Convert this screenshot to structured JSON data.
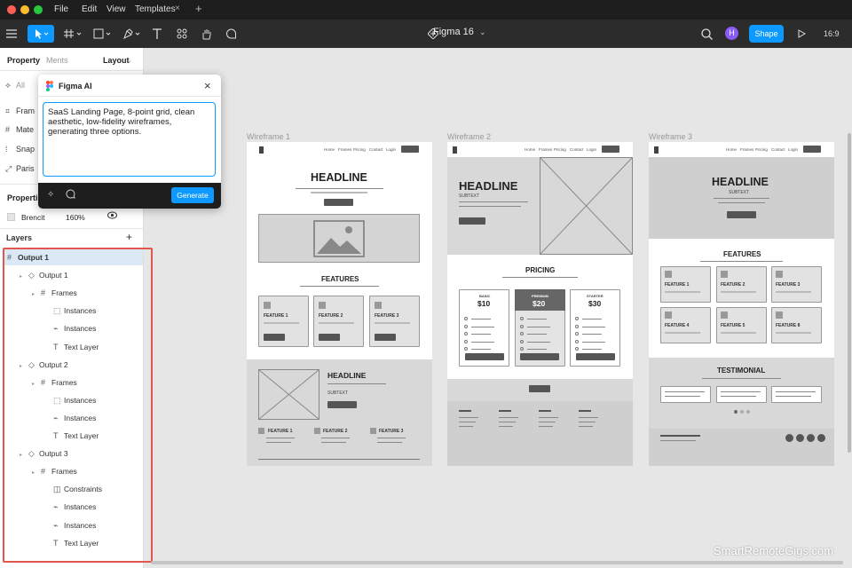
{
  "menu": {
    "file": "File",
    "edit": "Edit",
    "view": "View",
    "tab": "Templates",
    "tab_close": "×",
    "new_tab": "+"
  },
  "toolbar": {
    "filename": "Figma 16",
    "avatar": "H",
    "share": "Shape",
    "ratio": "16:9"
  },
  "panel": {
    "tabs": [
      "Property",
      "Ments",
      "Layout"
    ],
    "filter": "All",
    "menu_items": [
      "Fram",
      "Mate",
      "Snap",
      "Paris"
    ],
    "properties_title": "Propertie",
    "prop_name": "Brencit",
    "prop_value": "160%",
    "layers_title": "Layers",
    "add": "+"
  },
  "tree": [
    {
      "label": "Output 1",
      "level": 0,
      "icon": "#"
    },
    {
      "label": "Output 1",
      "level": 1,
      "icon": "◇"
    },
    {
      "label": "Frames",
      "level": 2,
      "icon": "#"
    },
    {
      "label": "Instances",
      "level": 3,
      "icon": "⬚"
    },
    {
      "label": "Instances",
      "level": 3,
      "icon": "⌁"
    },
    {
      "label": "Text Layer",
      "level": 3,
      "icon": "T"
    },
    {
      "label": "Output 2",
      "level": 1,
      "icon": "◇"
    },
    {
      "label": "Frames",
      "level": 2,
      "icon": "#"
    },
    {
      "label": "Instances",
      "level": 3,
      "icon": "⬚"
    },
    {
      "label": "Instances",
      "level": 3,
      "icon": "⌁"
    },
    {
      "label": "Text Layer",
      "level": 3,
      "icon": "T"
    },
    {
      "label": "Output 3",
      "level": 1,
      "icon": "◇"
    },
    {
      "label": "Frames",
      "level": 2,
      "icon": "#"
    },
    {
      "label": "Constraints",
      "level": 3,
      "icon": "◫"
    },
    {
      "label": "Instances",
      "level": 3,
      "icon": "⌁"
    },
    {
      "label": "Instances",
      "level": 3,
      "icon": "⌁"
    },
    {
      "label": "Text Layer",
      "level": 3,
      "icon": "T"
    }
  ],
  "ai": {
    "title": "Figma AI",
    "prompt": "SaaS Landing Page, 8-point grid, clean aesthetic, low-fidelity wireframes, generating three options.",
    "generate": "Generate"
  },
  "wireframes": [
    {
      "label": "Wireframe 1",
      "headline": "HEADLINE",
      "section": "FEATURES",
      "features": [
        "FEATURE 1",
        "FEATURE 2",
        "FEATURE 3"
      ],
      "headline2": "HEADLINE",
      "subtext": "SUBTEXT",
      "nav": [
        "Home",
        "Frames",
        "Pricing",
        "Contact",
        "Login"
      ]
    },
    {
      "label": "Wireframe 2",
      "headline": "HEADLINE",
      "subtext": "SUBTEXT",
      "section": "PRICING",
      "plans": [
        {
          "name": "BASIC",
          "price": "$10"
        },
        {
          "name": "PREMIUM",
          "price": "$20"
        },
        {
          "name": "STARTER",
          "price": "$30"
        }
      ],
      "nav": [
        "Home",
        "Frames",
        "Pricing",
        "Contact",
        "Login"
      ]
    },
    {
      "label": "Wireframe 3",
      "headline": "HEADLINE",
      "subtext": "SUBTEXT",
      "section": "FEATURES",
      "features": [
        "FEATURE 1",
        "FEATURE 2",
        "FEATURE 3",
        "FEATURE 4",
        "FEATURE 5",
        "FEATURE 8"
      ],
      "testimonial": "TESTIMONIAL",
      "nav": [
        "Home",
        "Frames",
        "Pricing",
        "Contact",
        "Login"
      ]
    }
  ],
  "watermark": "SmartRemoteGigs.com"
}
